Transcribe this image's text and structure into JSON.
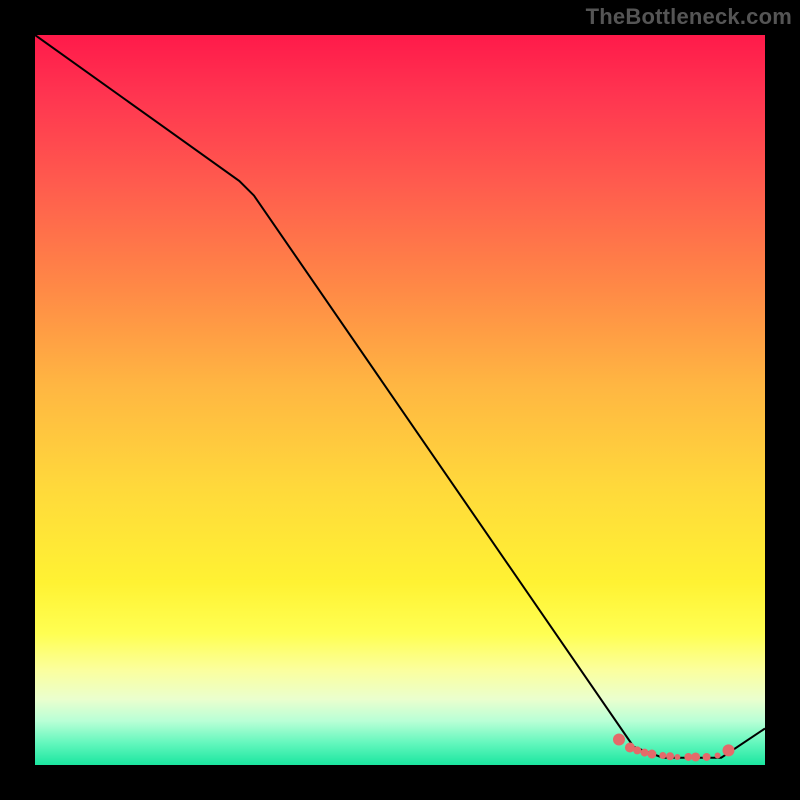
{
  "watermark": "TheBottleneck.com",
  "chart_data": {
    "type": "line",
    "title": "",
    "xlabel": "",
    "ylabel": "",
    "xlim": [
      0,
      100
    ],
    "ylim": [
      0,
      100
    ],
    "series": [
      {
        "name": "curve",
        "x": [
          0,
          28,
          30,
          82,
          86,
          94,
          100
        ],
        "values": [
          100,
          80,
          78,
          2.5,
          1,
          1,
          5
        ],
        "stroke": "#000000",
        "stroke_width": 2
      }
    ],
    "markers": {
      "name": "bottom-cluster",
      "color": "#e46a6a",
      "points": [
        {
          "x": 80,
          "y": 3.5,
          "r": 6
        },
        {
          "x": 81.5,
          "y": 2.4,
          "r": 5
        },
        {
          "x": 82.5,
          "y": 2.0,
          "r": 4
        },
        {
          "x": 83.5,
          "y": 1.7,
          "r": 4
        },
        {
          "x": 84.5,
          "y": 1.5,
          "r": 4.5
        },
        {
          "x": 86,
          "y": 1.3,
          "r": 3.5
        },
        {
          "x": 87,
          "y": 1.2,
          "r": 4
        },
        {
          "x": 88,
          "y": 1.1,
          "r": 3
        },
        {
          "x": 89.5,
          "y": 1.1,
          "r": 4
        },
        {
          "x": 90.5,
          "y": 1.1,
          "r": 4.5
        },
        {
          "x": 92,
          "y": 1.1,
          "r": 4
        },
        {
          "x": 93.5,
          "y": 1.3,
          "r": 3
        },
        {
          "x": 95,
          "y": 2.0,
          "r": 6
        }
      ]
    }
  }
}
